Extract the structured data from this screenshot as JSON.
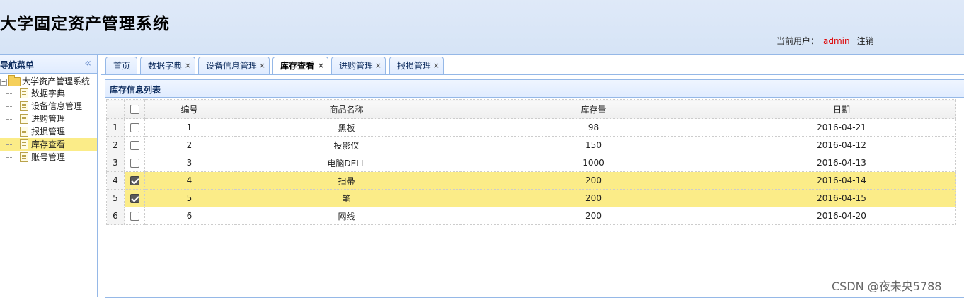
{
  "header": {
    "title": "大学固定资产管理系统",
    "user_label": "当前用户：",
    "username": "admin",
    "logout": "注销"
  },
  "nav": {
    "title": "导航菜单",
    "collapse": "«",
    "root": "大学资产管理系统",
    "items": [
      {
        "label": "数据字典"
      },
      {
        "label": "设备信息管理"
      },
      {
        "label": "进购管理"
      },
      {
        "label": "报损管理"
      },
      {
        "label": "库存查看"
      },
      {
        "label": "账号管理"
      }
    ]
  },
  "tabs": [
    {
      "label": "首页"
    },
    {
      "label": "数据字典"
    },
    {
      "label": "设备信息管理"
    },
    {
      "label": "库存查看"
    },
    {
      "label": "进购管理"
    },
    {
      "label": "报损管理"
    }
  ],
  "tab_close": "×",
  "panel": {
    "title": "库存信息列表"
  },
  "grid": {
    "columns": [
      "编号",
      "商品名称",
      "库存量",
      "日期"
    ],
    "rows": [
      {
        "num": "1",
        "checked": false,
        "id": "1",
        "name": "黑板",
        "qty": "98",
        "date": "2016-04-21"
      },
      {
        "num": "2",
        "checked": false,
        "id": "2",
        "name": "投影仪",
        "qty": "150",
        "date": "2016-04-12"
      },
      {
        "num": "3",
        "checked": false,
        "id": "3",
        "name": "电脑DELL",
        "qty": "1000",
        "date": "2016-04-13"
      },
      {
        "num": "4",
        "checked": true,
        "id": "4",
        "name": "扫帚",
        "qty": "200",
        "date": "2016-04-14"
      },
      {
        "num": "5",
        "checked": true,
        "id": "5",
        "name": "笔",
        "qty": "200",
        "date": "2016-04-15"
      },
      {
        "num": "6",
        "checked": false,
        "id": "6",
        "name": "网线",
        "qty": "200",
        "date": "2016-04-20"
      }
    ]
  },
  "watermark": "CSDN @夜未央5788"
}
